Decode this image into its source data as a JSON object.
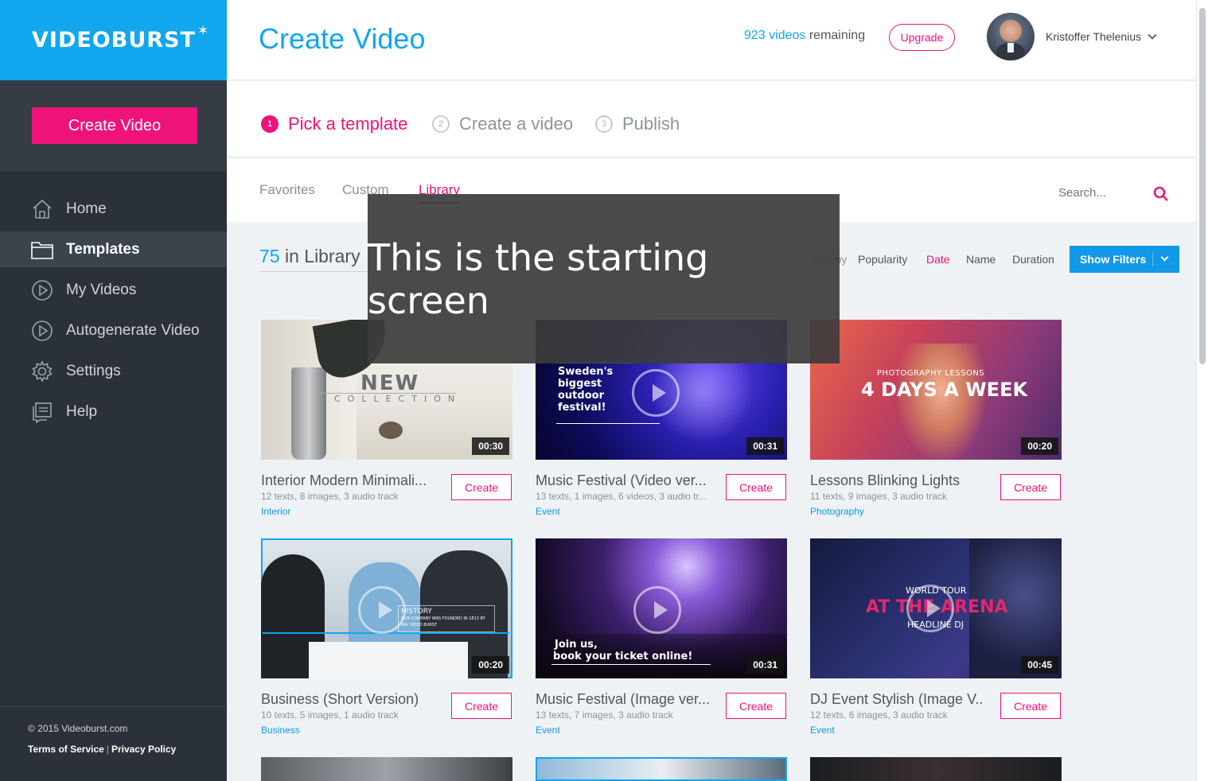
{
  "sidebar": {
    "logo": "VIDEOBURST",
    "create_button": "Create Video",
    "items": [
      {
        "label": "Home",
        "icon": "home-icon"
      },
      {
        "label": "Templates",
        "icon": "folder-icon",
        "active": true
      },
      {
        "label": "My Videos",
        "icon": "play-circle-icon"
      },
      {
        "label": "Autogenerate Video",
        "icon": "play-circle-icon"
      },
      {
        "label": "Settings",
        "icon": "gear-icon"
      },
      {
        "label": "Help",
        "icon": "help-icon"
      }
    ],
    "footer": {
      "copyright": "© 2015 Videoburst.com",
      "terms": "Terms of Service",
      "separator": "|",
      "privacy": "Privacy Policy"
    }
  },
  "header": {
    "title": "Create Video",
    "remaining_count": "923 videos",
    "remaining_suffix": "remaining",
    "upgrade": "Upgrade",
    "user_name": "Kristoffer Thelenius"
  },
  "steps": [
    {
      "num": "1",
      "label": "Pick a template",
      "active": true
    },
    {
      "num": "2",
      "label": "Create a video"
    },
    {
      "num": "3",
      "label": "Publish"
    }
  ],
  "tabs": [
    {
      "label": "Favorites"
    },
    {
      "label": "Custom"
    },
    {
      "label": "Library",
      "active": true
    }
  ],
  "search": {
    "placeholder": "Search..."
  },
  "library": {
    "count": "75",
    "label": "in Library",
    "sort_label": "Sort by",
    "sort_options": [
      {
        "label": "Popularity"
      },
      {
        "label": "Date",
        "active": true
      },
      {
        "label": "Name"
      },
      {
        "label": "Duration"
      }
    ],
    "filters_button": "Show Filters"
  },
  "cards": [
    {
      "title": "Interior Modern Minimali...",
      "meta": "12 texts, 8 images, 3 audio track",
      "category": "Interior",
      "duration": "00:30",
      "button": "Create",
      "thumb_text": [
        "NEW",
        "COLLECTION"
      ]
    },
    {
      "title": "Music Festival (Video ver...",
      "meta": "13 texts, 1 images, 6 videos, 3 audio tr...",
      "category": "Event",
      "duration": "00:31",
      "button": "Create",
      "thumb_text": [
        "Sweden's",
        "biggest",
        "outdoor",
        "festival!"
      ]
    },
    {
      "title": "Lessons Blinking Lights",
      "meta": "11 texts, 9 images, 3 audio track",
      "category": "Photography",
      "duration": "00:20",
      "button": "Create",
      "thumb_text": [
        "PHOTOGRAPHY LESSONS",
        "4 DAYS A WEEK"
      ]
    },
    {
      "title": "Business (Short Version)",
      "meta": "10 texts, 5 images, 1 audio track",
      "category": "Business",
      "duration": "00:20",
      "button": "Create",
      "thumb_text": [
        "HISTORY",
        "OUR COMPANY WAS FOUNDED IN 1813 BY",
        "MR. VIDEO BURST"
      ]
    },
    {
      "title": "Music Festival (Image ver...",
      "meta": "13 texts, 7 images, 3 audio track",
      "category": "Event",
      "duration": "00:31",
      "button": "Create",
      "thumb_text": [
        "Join us,",
        "book your ticket online!"
      ]
    },
    {
      "title": "DJ Event Stylish (Image V..",
      "meta": "12 texts, 6 images, 3 audio track",
      "category": "Event",
      "duration": "00:45",
      "button": "Create",
      "thumb_text": [
        "WORLD TOUR",
        "AT THE ARENA",
        "HEADLINE DJ"
      ]
    }
  ],
  "overlay": {
    "text": "This is the starting screen"
  }
}
